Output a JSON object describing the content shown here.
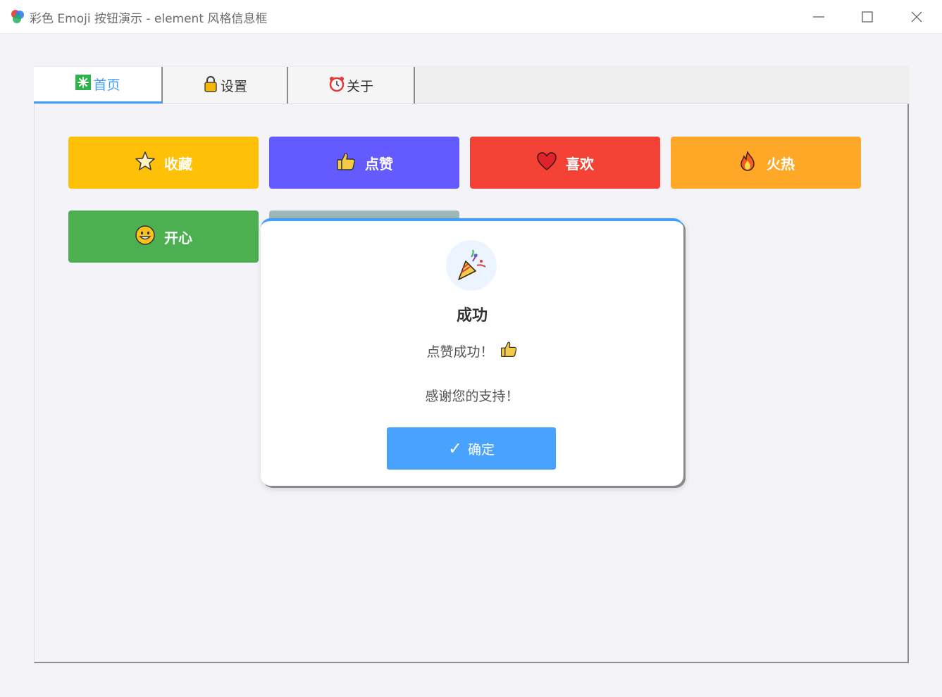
{
  "window": {
    "title": "彩色 Emoji 按钮演示 - element 风格信息框",
    "app_icon": "paint-icon",
    "controls": [
      "minimize-icon",
      "maximize-icon",
      "close-icon"
    ]
  },
  "tabs": [
    {
      "label": "首页",
      "icon": "sparkle-icon",
      "active": true
    },
    {
      "label": "设置",
      "icon": "lock-icon",
      "active": false
    },
    {
      "label": "关于",
      "icon": "alarm-clock-icon",
      "active": false
    }
  ],
  "buttons": [
    {
      "label": "收藏",
      "icon": "star-icon",
      "color": "#ffc107"
    },
    {
      "label": "点赞",
      "icon": "thumbs-up-icon",
      "color": "#635bff"
    },
    {
      "label": "喜欢",
      "icon": "heart-icon",
      "color": "#f44336"
    },
    {
      "label": "火热",
      "icon": "fire-icon",
      "color": "#ffa726"
    },
    {
      "label": "开心",
      "icon": "smile-icon",
      "color": "#4caf50"
    },
    {
      "label": "",
      "icon": "rocket-icon",
      "color": "#9cb8b8"
    }
  ],
  "dialog": {
    "icon": "party-popper-icon",
    "title": "成功",
    "message": "点赞成功！",
    "message_icon": "thumbs-up-icon",
    "message2": "感谢您的支持！",
    "ok_check": "✓",
    "ok_label": "确定",
    "accent": "#409eff"
  }
}
